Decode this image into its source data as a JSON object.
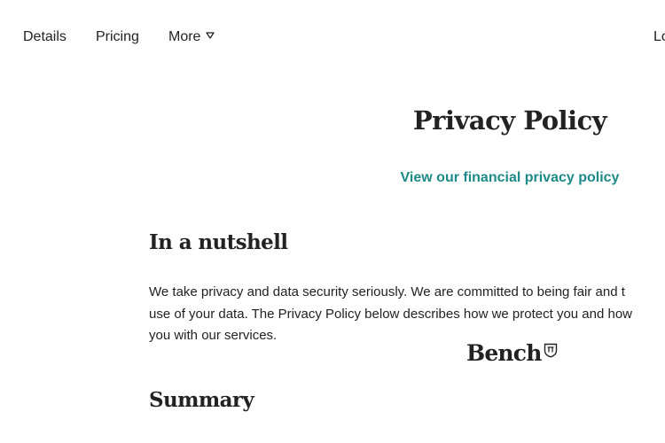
{
  "nav": {
    "items": [
      {
        "label": "Details"
      },
      {
        "label": "Pricing"
      },
      {
        "label": "More"
      }
    ],
    "more_icon": "triangle-down-icon",
    "login_label": "Lo"
  },
  "main": {
    "title": "Privacy Policy",
    "financial_link": "View our financial privacy policy",
    "nutshell_heading": "In a nutshell",
    "nutshell_lines": [
      "We take privacy and data security seriously. We are committed to being fair and t",
      "use of your data. The Privacy Policy below describes how we protect you and how",
      "you with our services."
    ],
    "summary_heading": "Summary"
  },
  "logo": {
    "text": "Bench",
    "mark_icon": "bench-shield-icon"
  },
  "colors": {
    "text": "#222222",
    "link": "#1e8a88",
    "background": "#ffffff"
  }
}
